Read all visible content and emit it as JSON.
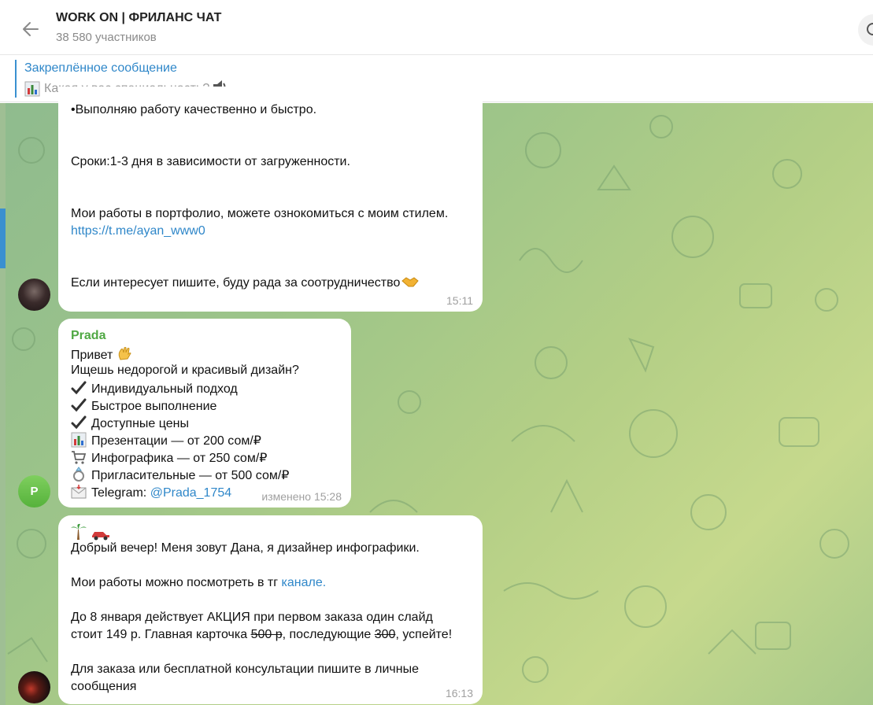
{
  "header": {
    "title": "WORK ON | ФРИЛАНС ЧАТ",
    "members": "38 580 участников"
  },
  "pinned": {
    "title": "Закреплённое сообщение",
    "text": "Какая у вас специальность?"
  },
  "messages": [
    {
      "lines": [
        "•Выполняю работу качественно и быстро.",
        "Сроки:1-3 дня в зависимости от загруженности.",
        "Мои работы в портфолио, можете ознокомиться с моим стилем.",
        "https://t.me/ayan_www0",
        "Если интересует  пишите, буду рада за соотрудничество"
      ],
      "time": "15:11"
    },
    {
      "sender": "Prada",
      "greeting": "Привет",
      "question": "Ищешь недорогой и красивый дизайн?",
      "items": [
        "Индивидуальный подход",
        "Быстрое выполнение",
        "Доступные цены",
        "Презентации — от 200 сом/₽",
        "Инфографика — от 250 сом/₽",
        "Пригласительные — от 500 сом/₽"
      ],
      "telegram_label": "Telegram:",
      "telegram_handle": "@Prada_1754",
      "time": "изменено 15:28",
      "avatar_letter": "P"
    },
    {
      "line1": "Добрый вечер! Меня зовут Дана, я дизайнер инфографики.",
      "line2_text": "Мои работы можно посмотреть в тг ",
      "line2_link": "каналe.",
      "line3": "До 8 января действует АКЦИЯ при первом заказа один слайд",
      "line4_a": "стоит 149 р. Главная карточка ",
      "line4_strike1": "500 р",
      "line4_b": ", последующие ",
      "line4_strike2": "300",
      "line4_c": ", успейте!",
      "line5": "Для заказа или бесплатной консультации пишите в личные",
      "line6": "сообщения",
      "time": "16:13"
    }
  ],
  "colors": {
    "link": "#2f87c9",
    "sender": "#4fa843",
    "chat_bg_start": "#8fbb8e",
    "chat_bg_end": "#c6d98d"
  }
}
